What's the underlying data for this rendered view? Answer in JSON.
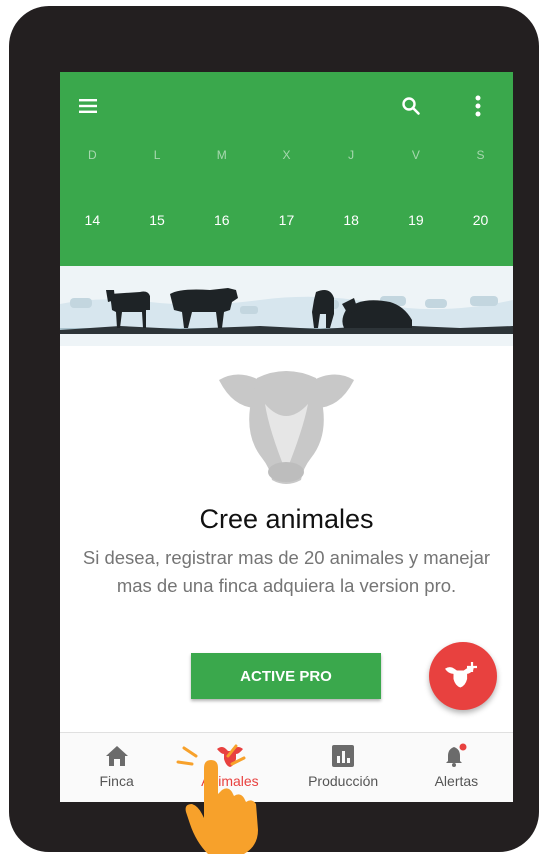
{
  "calendar": {
    "days": [
      "D",
      "L",
      "M",
      "X",
      "J",
      "V",
      "S"
    ],
    "dates": [
      "14",
      "15",
      "16",
      "17",
      "18",
      "19",
      "20"
    ]
  },
  "empty_state": {
    "title": "Cree animales",
    "message": "Si desea, registrar mas de 20 animales y manejar mas de una finca adquiera la version pro.",
    "button_label": "ACTIVE PRO"
  },
  "bottom_nav": {
    "items": [
      {
        "label": "Finca",
        "icon": "home-icon"
      },
      {
        "label": "Animales",
        "icon": "cow-icon"
      },
      {
        "label": "Producción",
        "icon": "chart-icon"
      },
      {
        "label": "Alertas",
        "icon": "bell-icon"
      }
    ],
    "active_index": 1
  },
  "colors": {
    "primary": "#3aa84c",
    "accent": "#e8413f",
    "device": "#231f20"
  }
}
